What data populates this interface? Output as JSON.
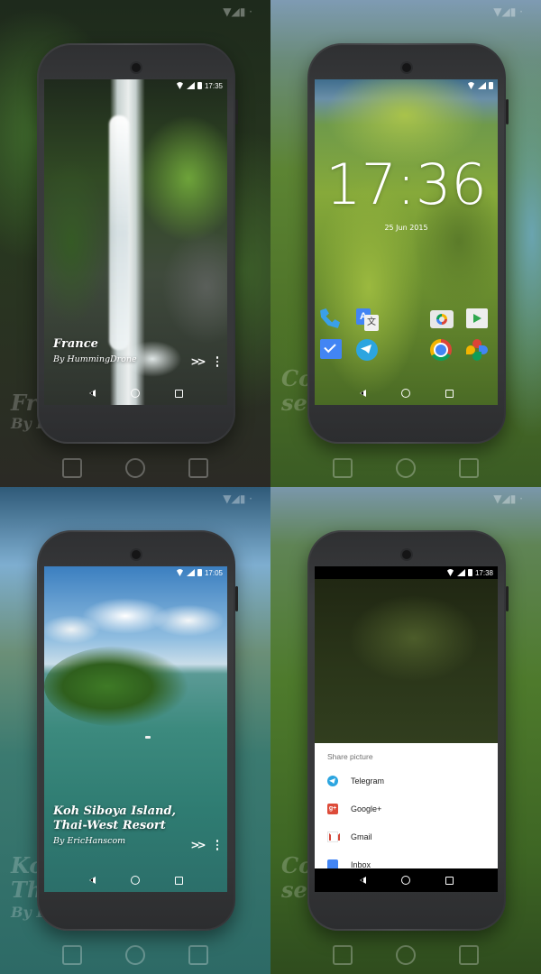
{
  "colors": {
    "telegram_blue": "#2CA5E0",
    "google_blue": "#4285F4",
    "google_red": "#DB4437",
    "google_yellow": "#F4B400",
    "google_green": "#0F9D58"
  },
  "screens": [
    {
      "status_time": "17:35",
      "caption": {
        "title": "France",
        "author": "By HummingDrone"
      },
      "actions": {
        "skip_icon": "fast-forward-icon",
        "more_icon": "more-vert-icon"
      }
    },
    {
      "status_time": "",
      "clock": "17:36",
      "date": "25 Jun 2015",
      "apps_row1": [
        "phone-icon",
        "google-translate-icon",
        "google-camera-icon",
        "play-store-icon"
      ],
      "apps_row2": [
        "inbox-icon",
        "telegram-icon",
        "chrome-icon",
        "google-photos-icon"
      ]
    },
    {
      "status_time": "17:05",
      "caption": {
        "title_line1": "Koh Siboya Island,",
        "title_line2": "Thai-West Resort",
        "author": "By EricHanscom"
      },
      "actions": {
        "skip_icon": "fast-forward-icon",
        "more_icon": "more-vert-icon"
      }
    },
    {
      "status_time": "17:38",
      "share_sheet": {
        "title": "Share picture",
        "items": [
          {
            "label": "Telegram",
            "icon": "telegram-icon"
          },
          {
            "label": "Google+",
            "icon": "google-plus-icon"
          },
          {
            "label": "Gmail",
            "icon": "gmail-icon"
          },
          {
            "label": "Inbox",
            "icon": "inbox-icon"
          }
        ]
      }
    }
  ],
  "background_ghost_text": {
    "q1": [
      "Fra",
      "By H"
    ],
    "q2": [
      "Co",
      "se"
    ],
    "q3": [
      "Ko",
      "Th",
      "By E"
    ],
    "q4": [
      "Co",
      "se"
    ]
  },
  "navigation": [
    "back-icon",
    "home-icon",
    "recents-icon"
  ]
}
